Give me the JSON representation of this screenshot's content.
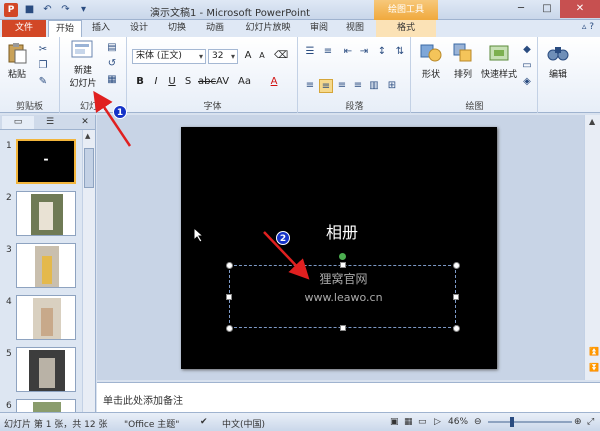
{
  "window": {
    "title": "演示文稿1 - Microsoft PowerPoint",
    "context_tab_header": "绘图工具",
    "logo_letter": "P"
  },
  "tabs": [
    "文件",
    "开始",
    "插入",
    "设计",
    "切换",
    "动画",
    "幻灯片放映",
    "审阅",
    "视图",
    "格式"
  ],
  "ribbon": {
    "clipboard": {
      "paste": "粘贴",
      "label": "剪贴板"
    },
    "slides": {
      "new_slide_line1": "新建",
      "new_slide_line2": "幻灯片",
      "label": "幻灯片"
    },
    "font": {
      "font_name": "宋体 (正文)",
      "font_size": "32",
      "label": "字体"
    },
    "paragraph": {
      "label": "段落"
    },
    "drawing": {
      "shape": "形状",
      "arrange": "排列",
      "quick_styles": "快速样式",
      "label": "绘图"
    },
    "editing": {
      "edit": "编辑"
    }
  },
  "slide": {
    "title": "相册",
    "subtitle_line1": "狸窝官网",
    "subtitle_line2": "www.leawo.cn"
  },
  "thumbnails": [
    "1",
    "2",
    "3",
    "4",
    "5",
    "6"
  ],
  "notes_placeholder": "单击此处添加备注",
  "status": {
    "slide_info": "幻灯片 第 1 张，共 12 张",
    "theme": "\"Office 主题\"",
    "language": "中文(中国)",
    "zoom": "46%"
  },
  "annotations": {
    "badge1": "1",
    "badge2": "2"
  },
  "colors": {
    "file_tab": "#d24726",
    "accent": "#2a4c80",
    "annotation_badge": "#1533c8",
    "annotation_arrow": "#e02020"
  }
}
